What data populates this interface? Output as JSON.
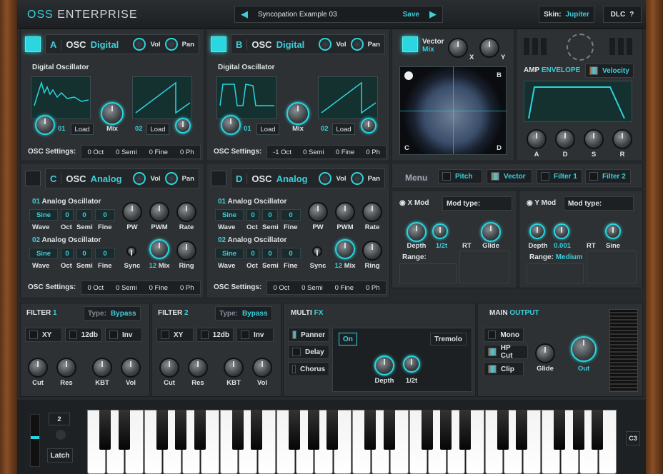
{
  "app": {
    "logo_part1": "OSS",
    "logo_part2": " ENTERPRISE"
  },
  "preset": {
    "name": "Syncopation Example 03",
    "save_label": "Save",
    "prev_icon": "◀",
    "next_icon": "▶"
  },
  "skin": {
    "label": "Skin:",
    "value": "Jupiter"
  },
  "dlc": {
    "label": "DLC",
    "help": "?"
  },
  "oscA": {
    "letter": "A",
    "osc": "OSC",
    "type": "Digital",
    "vol": "Vol",
    "pan": "Pan",
    "title": "Digital Oscillator",
    "wave1": "01",
    "wave2": "02",
    "load": "Load",
    "mix": "Mix",
    "settings_label": "OSC Settings:",
    "oct": "0 Oct",
    "semi": "0 Semi",
    "fine": "0 Fine",
    "ph": "0 Ph"
  },
  "oscB": {
    "letter": "B",
    "osc": "OSC",
    "type": "Digital",
    "vol": "Vol",
    "pan": "Pan",
    "title": "Digital Oscillator",
    "wave1": "01",
    "wave2": "02",
    "load": "Load",
    "mix": "Mix",
    "settings_label": "OSC Settings:",
    "oct": "-1 Oct",
    "semi": "0 Semi",
    "fine": "0 Fine",
    "ph": "0 Ph"
  },
  "oscC": {
    "letter": "C",
    "osc": "OSC",
    "type": "Analog",
    "vol": "Vol",
    "pan": "Pan",
    "a1_num": "01",
    "a1_title": "Analog Oscillator",
    "a2_num": "02",
    "a2_title": "Analog Oscillator",
    "wave_val": "Sine",
    "zero": "0",
    "wave": "Wave",
    "oct": "Oct",
    "semi": "Semi",
    "fine": "Fine",
    "pw": "PW",
    "pwm": "PWM",
    "rate": "Rate",
    "sync": "Sync",
    "mix_num": "12",
    "mix": "Mix",
    "ring": "Ring",
    "settings_label": "OSC Settings:",
    "s_oct": "0 Oct",
    "s_semi": "0 Semi",
    "s_fine": "0 Fine",
    "s_ph": "0 Ph"
  },
  "oscD": {
    "letter": "D",
    "osc": "OSC",
    "type": "Analog",
    "vol": "Vol",
    "pan": "Pan",
    "a1_num": "01",
    "a1_title": "Analog Oscillator",
    "a2_num": "02",
    "a2_title": "Analog Oscillator",
    "wave_val": "Sine",
    "zero": "0",
    "wave": "Wave",
    "oct": "Oct",
    "semi": "Semi",
    "fine": "Fine",
    "pw": "PW",
    "pwm": "PWM",
    "rate": "Rate",
    "sync": "Sync",
    "mix_num": "12",
    "mix": "Mix",
    "ring": "Ring",
    "settings_label": "OSC Settings:",
    "s_oct": "0 Oct",
    "s_semi": "0 Semi",
    "s_fine": "0 Fine",
    "s_ph": "0 Ph"
  },
  "vector": {
    "title1": "Vector",
    "title2": "Mix",
    "x": "X",
    "y": "Y",
    "corners": [
      "A",
      "B",
      "C",
      "D"
    ]
  },
  "amp": {
    "label1": "AMP",
    "label2": " ENVELOPE",
    "velocity": "Velocity",
    "knobs": [
      "A",
      "D",
      "S",
      "R"
    ]
  },
  "menu": {
    "title": "Menu",
    "items": [
      "Pitch",
      "Vector",
      "Filter 1",
      "Filter 2"
    ]
  },
  "xmod": {
    "title": "X Mod",
    "modtype": "Mod type:",
    "depth": "Depth",
    "rate_val": "1/2t",
    "rt": "RT",
    "glide": "Glide",
    "range": "Range:"
  },
  "ymod": {
    "title": "Y Mod",
    "modtype": "Mod type:",
    "depth": "Depth",
    "rate_val": "0.001",
    "rt": "RT",
    "sine": "Sine",
    "range": "Range:",
    "range_val": "Medium"
  },
  "filter1": {
    "title1": "FILTER",
    "title2": "1",
    "type_label": "Type:",
    "type_val": "Bypass",
    "xy": "XY",
    "db": "12db",
    "inv": "Inv",
    "cut": "Cut",
    "res": "Res",
    "kbt": "KBT",
    "vol": "Vol"
  },
  "filter2": {
    "title1": "FILTER",
    "title2": "2",
    "type_label": "Type:",
    "type_val": "Bypass",
    "xy": "XY",
    "db": "12db",
    "inv": "Inv",
    "cut": "Cut",
    "res": "Res",
    "kbt": "KBT",
    "vol": "Vol"
  },
  "fx": {
    "title1": "MULTI",
    "title2": " FX",
    "items": [
      "Panner",
      "Delay",
      "Chorus"
    ],
    "on": "On",
    "effect": "Tremolo",
    "depth": "Depth",
    "rate": "1/2t"
  },
  "output": {
    "title1": "MAIN",
    "title2": " OUTPUT",
    "mono": "Mono",
    "hpcut": "HP Cut",
    "clip": "Clip",
    "glide": "Glide",
    "out": "Out"
  },
  "keyboard": {
    "octave": "2",
    "latch": "Latch",
    "note": "C3"
  },
  "colors": {
    "accent": "#3ccfdc",
    "panel": "#2d3133"
  }
}
